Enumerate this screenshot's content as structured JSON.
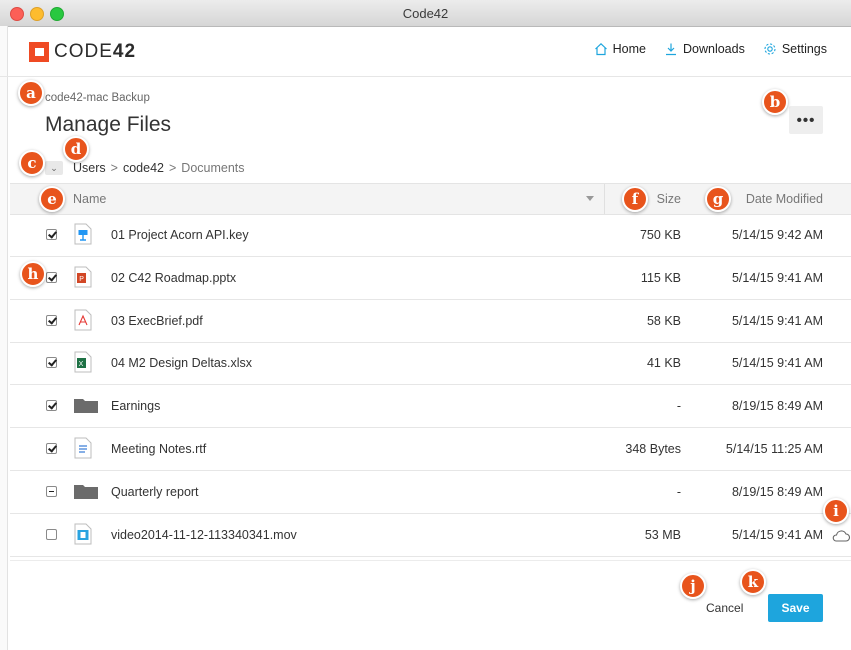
{
  "window": {
    "title": "Code42"
  },
  "brand": {
    "logo_text_light": "CODE",
    "logo_text_bold": "42",
    "accent_color": "#ef4a23"
  },
  "nav": {
    "home": "Home",
    "downloads": "Downloads",
    "settings": "Settings"
  },
  "page": {
    "subtitle": "code42-mac Backup",
    "title": "Manage Files",
    "more_label": "•••"
  },
  "breadcrumb": {
    "items": [
      "Users",
      "code42",
      "Documents"
    ],
    "separator": ">"
  },
  "table": {
    "columns": {
      "name": "Name",
      "size": "Size",
      "date": "Date Modified"
    },
    "rows": [
      {
        "name": "01 Project Acorn API.key",
        "size": "750 KB",
        "date": "5/14/15 9:42 AM",
        "checked": "checked",
        "icon": "keynote-icon"
      },
      {
        "name": "02 C42 Roadmap.pptx",
        "size": "115 KB",
        "date": "5/14/15 9:41 AM",
        "checked": "checked",
        "icon": "powerpoint-icon"
      },
      {
        "name": "03 ExecBrief.pdf",
        "size": "58 KB",
        "date": "5/14/15 9:41 AM",
        "checked": "checked",
        "icon": "pdf-icon"
      },
      {
        "name": "04 M2 Design Deltas.xlsx",
        "size": "41 KB",
        "date": "5/14/15 9:41 AM",
        "checked": "checked",
        "icon": "excel-icon"
      },
      {
        "name": "Earnings",
        "size": "-",
        "date": "8/19/15 8:49 AM",
        "checked": "checked",
        "icon": "folder-icon"
      },
      {
        "name": "Meeting Notes.rtf",
        "size": "348 Bytes",
        "date": "5/14/15 11:25 AM",
        "checked": "checked",
        "icon": "text-doc-icon"
      },
      {
        "name": "Quarterly report",
        "size": "-",
        "date": "8/19/15 8:49 AM",
        "checked": "partial",
        "icon": "folder-icon"
      },
      {
        "name": "video2014-11-12-113340341.mov",
        "size": "53 MB",
        "date": "5/14/15 9:41 AM",
        "checked": "unchecked",
        "icon": "video-icon"
      }
    ]
  },
  "actions": {
    "cancel": "Cancel",
    "save": "Save",
    "save_color": "#1ea5dd"
  },
  "callouts": [
    "a",
    "b",
    "c",
    "d",
    "e",
    "f",
    "g",
    "h",
    "i",
    "j",
    "k"
  ],
  "callout_color": "#e8541c"
}
